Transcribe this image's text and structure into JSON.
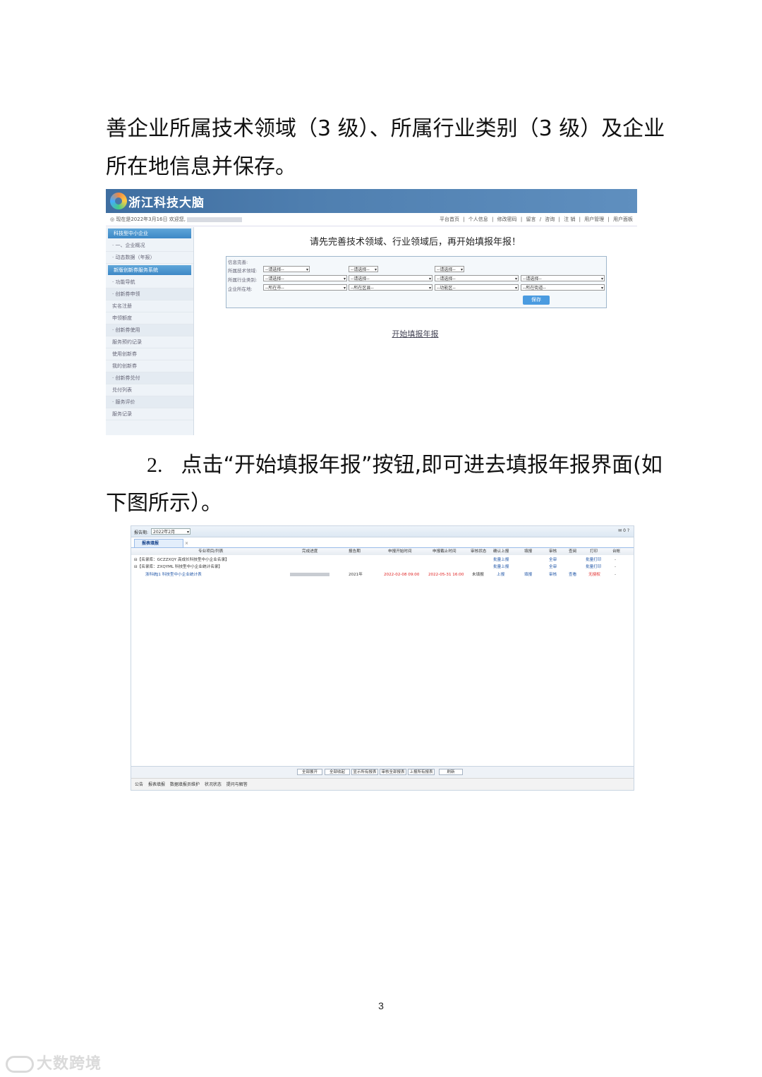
{
  "text": {
    "para1": "善企业所属技术领域（3 级）、所属行业类别（3 级）及企业所在地信息并保存。",
    "para2_num": "2.",
    "para2_line1": "点击“开始填报年报”按钮,即可进去填报年报界面(如",
    "para2_line2": "下图所示）。"
  },
  "shot1": {
    "logo_text": "浙江科技大脑",
    "welcome": "◎ 现在是2022年3月16日 欢迎您,",
    "topnav": [
      "平台首页",
      "|",
      "个人信息",
      "|",
      "修改密码",
      "|",
      "留言",
      "/",
      "咨询",
      "|",
      "注 销",
      "|",
      "用户管理",
      "|",
      "用户面板"
    ],
    "sidebar": {
      "h1": "科技型中小企业",
      "i1": "· 一、企业概况",
      "i2": "· 动态数据（年报）",
      "h2": "新版创新券服务系统",
      "i3": "· 功能导航",
      "g1": "· 创新券申领",
      "i4": "实名注册",
      "i5": "申领额度",
      "g2": "· 创新券使用",
      "i6": "服务预约记录",
      "i7": "使用创新券",
      "i8": "我的创新券",
      "g3": "· 创新券兑付",
      "i9": "兑付列表",
      "g4": "· 服务评价",
      "i10": "服务记录"
    },
    "notice": "请先完善技术领域、行业领域后，再开始填报年报！",
    "form": {
      "info_label": "信息完善:",
      "tech_label": "所属技术领域:",
      "industry_label": "所属行业类别:",
      "location_label": "企业所在地:",
      "please_select": "--请选择--",
      "city": "--所在市--",
      "district": "--所在区县--",
      "zone": "--功能区--",
      "street": "--所在街道--",
      "save": "保存"
    },
    "start_link": "开始填报年报"
  },
  "shot2": {
    "period_label": "报告期:",
    "period_value": "2022年2月",
    "toolbar_right": "0",
    "tab": "报表填报",
    "headers": [
      "专业项目/列表",
      "完成进度",
      "报告期",
      "申报开始时间",
      "申报截止时间",
      "审核状态",
      "确认上报",
      "填报",
      "审核",
      "查阅",
      "打印",
      "台帐"
    ],
    "rows": [
      {
        "name": "⊟【名录库：GCZZXQY 高成长科技型中小企业名录】",
        "confirm": "批量上报",
        "audit": "全审",
        "print": "批量打印",
        "ledger": "-"
      },
      {
        "name": "⊟【名录库：ZXQYML 科技型中小企业统计名录】",
        "confirm": "批量上报",
        "audit": "全审",
        "print": "批量打印",
        "ledger": "-"
      },
      {
        "name": "浙科统J1 科技型中小企业统计表",
        "period": "2021年",
        "start": "2022-02-08 09:00",
        "end": "2022-05-31 16:00",
        "status": "未填报",
        "confirm": "上报",
        "fill": "填报",
        "audit": "审核",
        "view": "查看",
        "print": "无授权",
        "ledger": "-"
      }
    ],
    "buttons": [
      "全部展开",
      "全部收起",
      "显示所有报表",
      "审核全部报表",
      "上报所有报表",
      "刷新"
    ],
    "statusbar": [
      "公告",
      "报表填报",
      "数据填报员维护",
      "状况状态",
      "提问与解答"
    ]
  },
  "page_number": "3",
  "watermark": "大数跨境"
}
